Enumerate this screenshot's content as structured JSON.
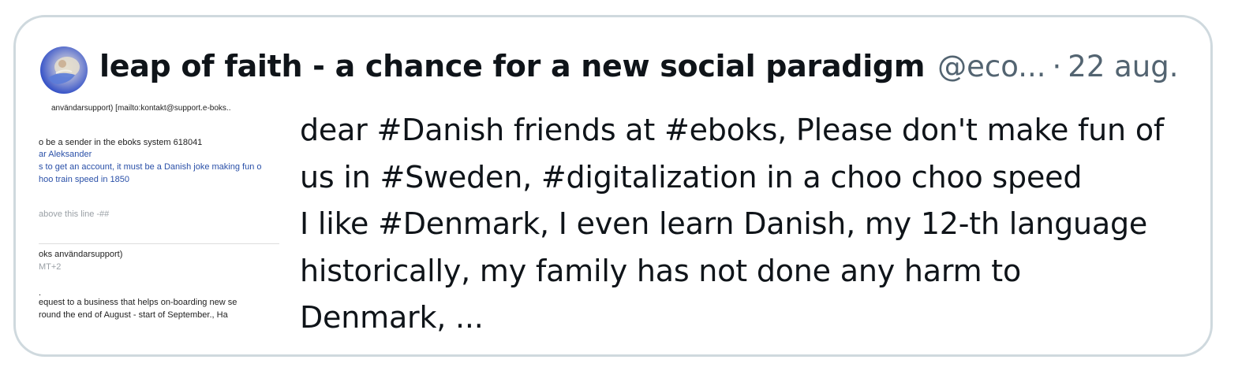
{
  "post": {
    "author_name": "leap of faith - a chance for a new social paradigm",
    "handle": "@eco...",
    "separator": "·",
    "date": "22 aug.",
    "text_lines": [
      "dear #Danish friends at #eboks, Please don't make fun of",
      "us in #Sweden, #digitalization in a choo choo speed",
      "I like #Denmark, I even learn Danish, my 12-th language",
      "historically, my family has not done any harm to",
      "Denmark, ..."
    ]
  },
  "thumbnail": {
    "lines": [
      "användarsupport) [mailto:kontakt@support.e-boks..",
      "o be a sender in the eboks system 618041",
      "ar Aleksander",
      "s to get an account, it must be a Danish joke making fun o",
      "hoo train speed in 1850",
      "above this line -##",
      "oks användarsupport)",
      "MT+2",
      ".",
      "equest to a business that helps on-boarding new se",
      "round the end of August - start of September., Ha"
    ]
  },
  "colors": {
    "border": "#cfd9de",
    "text_primary": "#0f1419",
    "text_secondary": "#536471",
    "link_blue": "#2a50a8"
  },
  "icons": {
    "avatar": "profile-avatar"
  }
}
